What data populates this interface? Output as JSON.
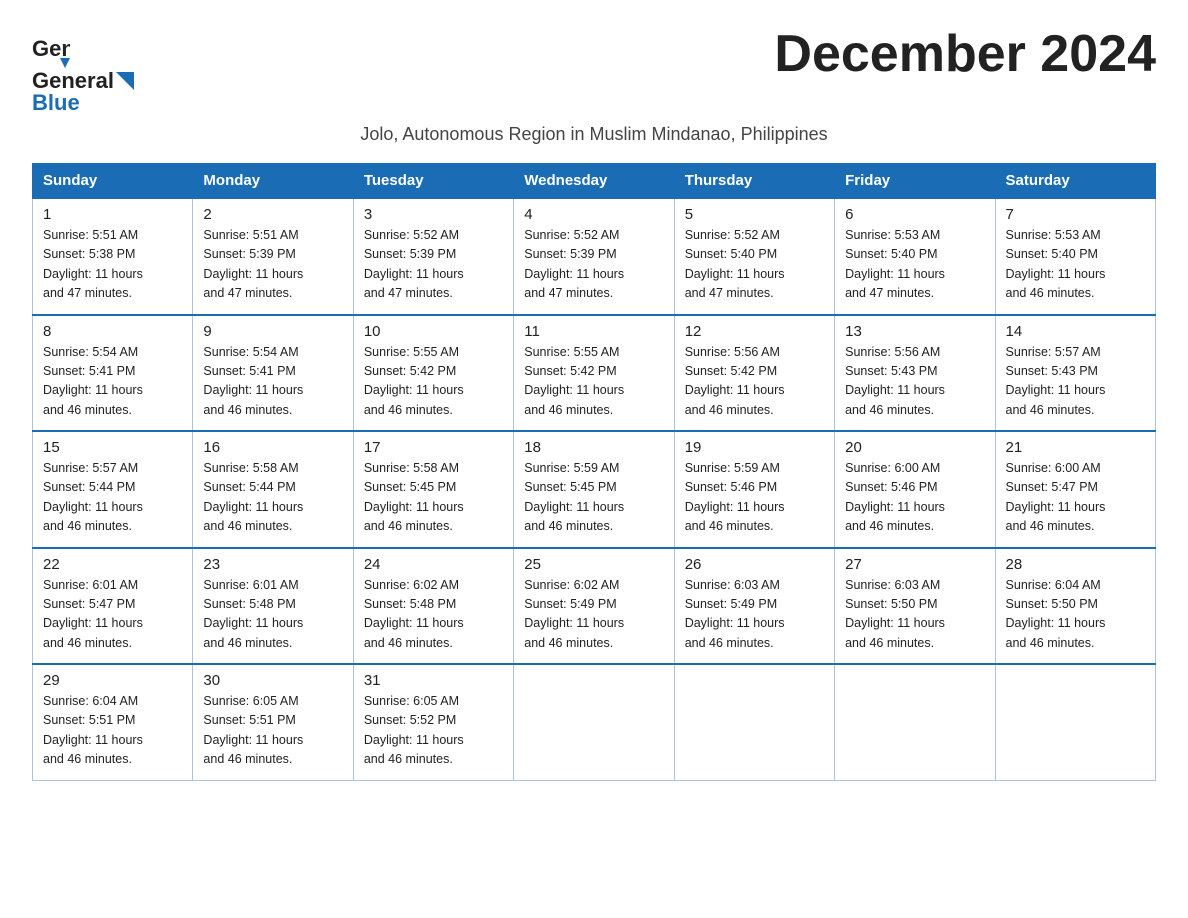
{
  "header": {
    "logo_general": "General",
    "logo_blue": "Blue",
    "title": "December 2024",
    "subtitle": "Jolo, Autonomous Region in Muslim Mindanao, Philippines"
  },
  "days_of_week": [
    "Sunday",
    "Monday",
    "Tuesday",
    "Wednesday",
    "Thursday",
    "Friday",
    "Saturday"
  ],
  "weeks": [
    [
      {
        "day": "1",
        "sunrise": "5:51 AM",
        "sunset": "5:38 PM",
        "daylight": "11 hours and 47 minutes."
      },
      {
        "day": "2",
        "sunrise": "5:51 AM",
        "sunset": "5:39 PM",
        "daylight": "11 hours and 47 minutes."
      },
      {
        "day": "3",
        "sunrise": "5:52 AM",
        "sunset": "5:39 PM",
        "daylight": "11 hours and 47 minutes."
      },
      {
        "day": "4",
        "sunrise": "5:52 AM",
        "sunset": "5:39 PM",
        "daylight": "11 hours and 47 minutes."
      },
      {
        "day": "5",
        "sunrise": "5:52 AM",
        "sunset": "5:40 PM",
        "daylight": "11 hours and 47 minutes."
      },
      {
        "day": "6",
        "sunrise": "5:53 AM",
        "sunset": "5:40 PM",
        "daylight": "11 hours and 47 minutes."
      },
      {
        "day": "7",
        "sunrise": "5:53 AM",
        "sunset": "5:40 PM",
        "daylight": "11 hours and 46 minutes."
      }
    ],
    [
      {
        "day": "8",
        "sunrise": "5:54 AM",
        "sunset": "5:41 PM",
        "daylight": "11 hours and 46 minutes."
      },
      {
        "day": "9",
        "sunrise": "5:54 AM",
        "sunset": "5:41 PM",
        "daylight": "11 hours and 46 minutes."
      },
      {
        "day": "10",
        "sunrise": "5:55 AM",
        "sunset": "5:42 PM",
        "daylight": "11 hours and 46 minutes."
      },
      {
        "day": "11",
        "sunrise": "5:55 AM",
        "sunset": "5:42 PM",
        "daylight": "11 hours and 46 minutes."
      },
      {
        "day": "12",
        "sunrise": "5:56 AM",
        "sunset": "5:42 PM",
        "daylight": "11 hours and 46 minutes."
      },
      {
        "day": "13",
        "sunrise": "5:56 AM",
        "sunset": "5:43 PM",
        "daylight": "11 hours and 46 minutes."
      },
      {
        "day": "14",
        "sunrise": "5:57 AM",
        "sunset": "5:43 PM",
        "daylight": "11 hours and 46 minutes."
      }
    ],
    [
      {
        "day": "15",
        "sunrise": "5:57 AM",
        "sunset": "5:44 PM",
        "daylight": "11 hours and 46 minutes."
      },
      {
        "day": "16",
        "sunrise": "5:58 AM",
        "sunset": "5:44 PM",
        "daylight": "11 hours and 46 minutes."
      },
      {
        "day": "17",
        "sunrise": "5:58 AM",
        "sunset": "5:45 PM",
        "daylight": "11 hours and 46 minutes."
      },
      {
        "day": "18",
        "sunrise": "5:59 AM",
        "sunset": "5:45 PM",
        "daylight": "11 hours and 46 minutes."
      },
      {
        "day": "19",
        "sunrise": "5:59 AM",
        "sunset": "5:46 PM",
        "daylight": "11 hours and 46 minutes."
      },
      {
        "day": "20",
        "sunrise": "6:00 AM",
        "sunset": "5:46 PM",
        "daylight": "11 hours and 46 minutes."
      },
      {
        "day": "21",
        "sunrise": "6:00 AM",
        "sunset": "5:47 PM",
        "daylight": "11 hours and 46 minutes."
      }
    ],
    [
      {
        "day": "22",
        "sunrise": "6:01 AM",
        "sunset": "5:47 PM",
        "daylight": "11 hours and 46 minutes."
      },
      {
        "day": "23",
        "sunrise": "6:01 AM",
        "sunset": "5:48 PM",
        "daylight": "11 hours and 46 minutes."
      },
      {
        "day": "24",
        "sunrise": "6:02 AM",
        "sunset": "5:48 PM",
        "daylight": "11 hours and 46 minutes."
      },
      {
        "day": "25",
        "sunrise": "6:02 AM",
        "sunset": "5:49 PM",
        "daylight": "11 hours and 46 minutes."
      },
      {
        "day": "26",
        "sunrise": "6:03 AM",
        "sunset": "5:49 PM",
        "daylight": "11 hours and 46 minutes."
      },
      {
        "day": "27",
        "sunrise": "6:03 AM",
        "sunset": "5:50 PM",
        "daylight": "11 hours and 46 minutes."
      },
      {
        "day": "28",
        "sunrise": "6:04 AM",
        "sunset": "5:50 PM",
        "daylight": "11 hours and 46 minutes."
      }
    ],
    [
      {
        "day": "29",
        "sunrise": "6:04 AM",
        "sunset": "5:51 PM",
        "daylight": "11 hours and 46 minutes."
      },
      {
        "day": "30",
        "sunrise": "6:05 AM",
        "sunset": "5:51 PM",
        "daylight": "11 hours and 46 minutes."
      },
      {
        "day": "31",
        "sunrise": "6:05 AM",
        "sunset": "5:52 PM",
        "daylight": "11 hours and 46 minutes."
      },
      null,
      null,
      null,
      null
    ]
  ],
  "labels": {
    "sunrise": "Sunrise:",
    "sunset": "Sunset:",
    "daylight": "Daylight:"
  }
}
